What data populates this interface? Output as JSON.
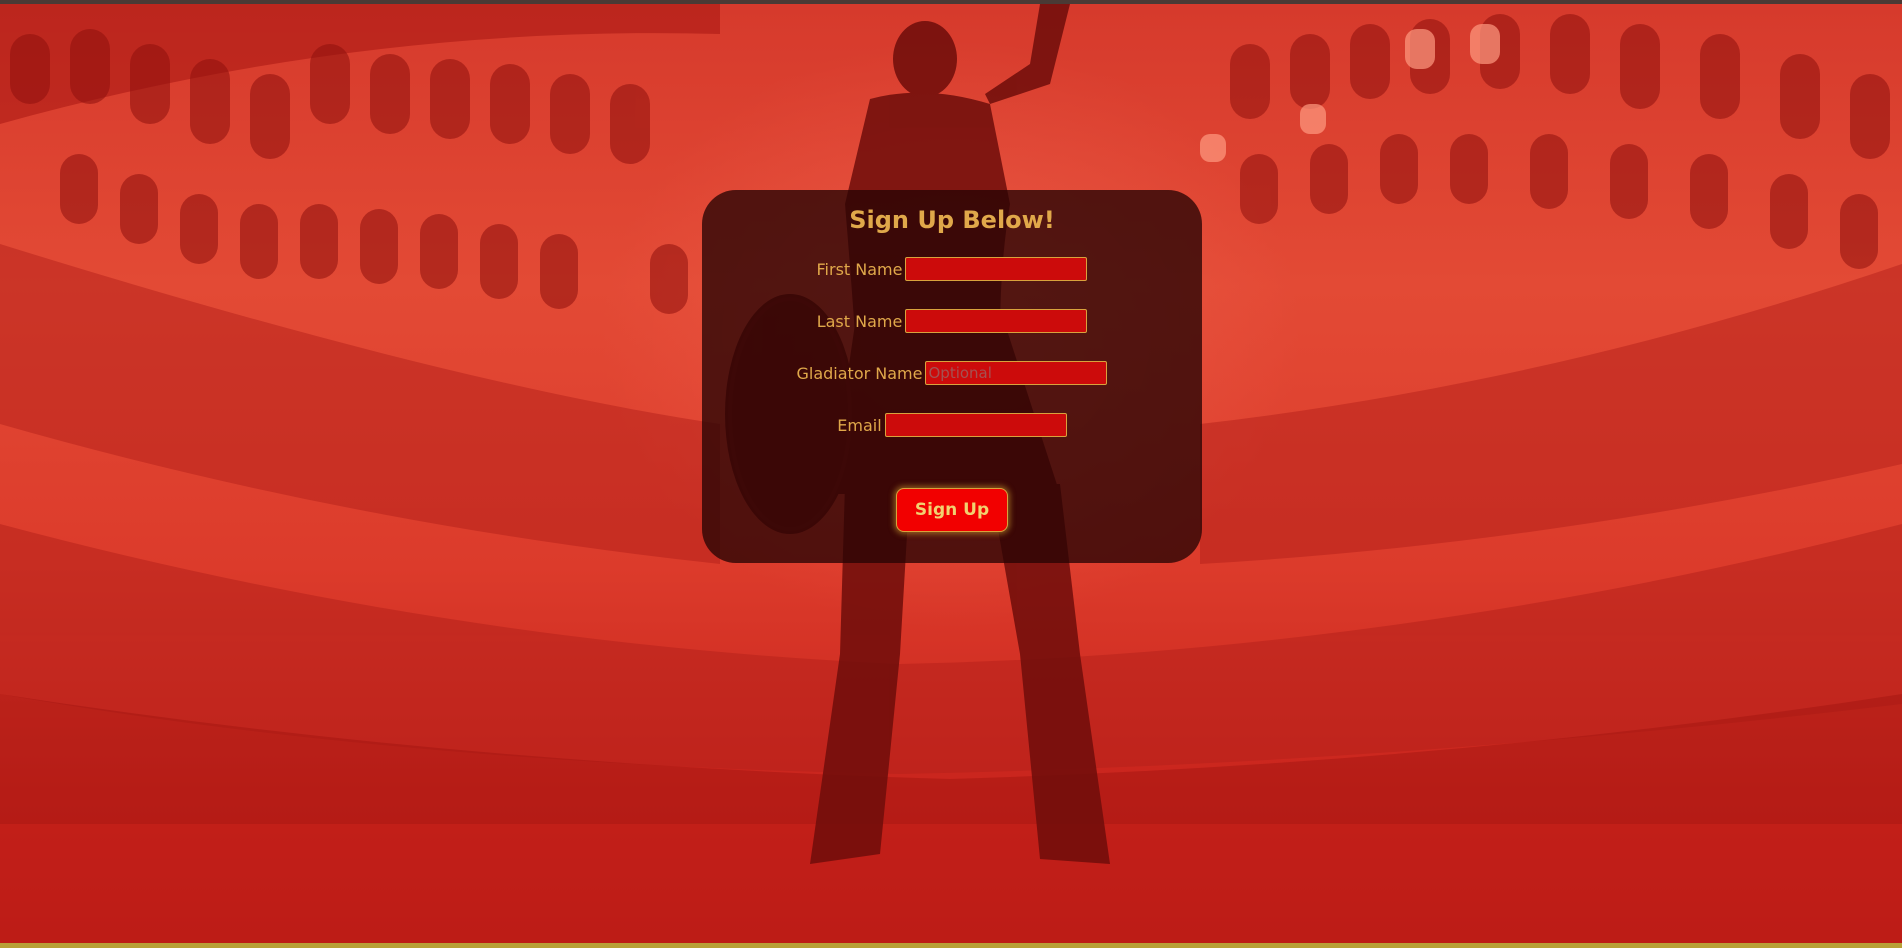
{
  "background": {
    "image_description_icon": "colosseum-gladiator-background",
    "tint_color": "#d9382a"
  },
  "form": {
    "title": "Sign Up Below!",
    "fields": [
      {
        "label": "First Name",
        "value": "",
        "placeholder": ""
      },
      {
        "label": "Last Name",
        "value": "",
        "placeholder": ""
      },
      {
        "label": "Gladiator Name",
        "value": "",
        "placeholder": "Optional"
      },
      {
        "label": "Email",
        "value": "",
        "placeholder": ""
      }
    ],
    "submit_label": "Sign Up"
  },
  "colors": {
    "accent_gold": "#e0a84a",
    "input_red": "#cc0b0b",
    "button_red": "#f20000",
    "card_bg": "rgba(40,4,4,0.78)"
  }
}
